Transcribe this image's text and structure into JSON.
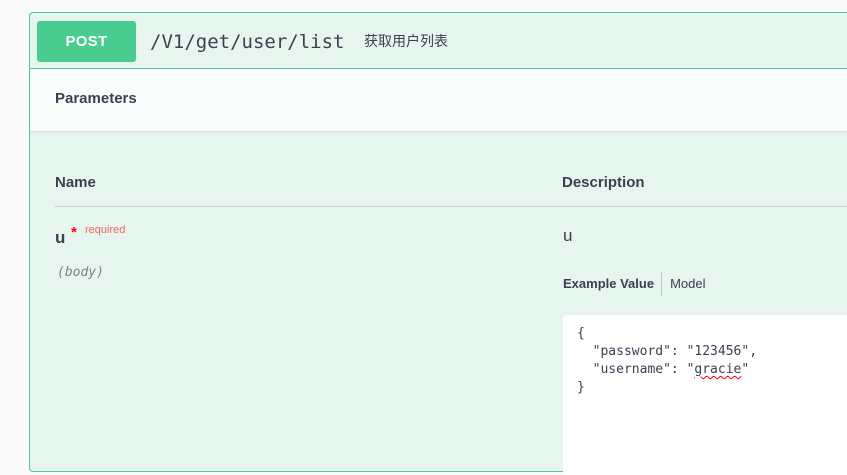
{
  "operation": {
    "method": "POST",
    "path": "/V1/get/user/list",
    "summary": "获取用户列表"
  },
  "parameters_section": {
    "title": "Parameters",
    "columns": {
      "name": "Name",
      "description": "Description"
    },
    "param": {
      "name": "u",
      "required_star": "*",
      "required_label": "required",
      "location": "(body)",
      "description": "u"
    },
    "example_tabs": {
      "example_value": "Example Value",
      "model": "Model"
    },
    "example_body": {
      "open": "{",
      "password_key": "  \"password\": ",
      "password_value": "\"123456\",",
      "username_key": "  \"username\": ",
      "username_value_prefix": "\"",
      "username_value_word": "gracie",
      "username_value_suffix": "\"",
      "close": "}"
    }
  },
  "colors": {
    "post_accent": "#49cc90",
    "text": "#3b4151",
    "required": "#ff0000"
  }
}
